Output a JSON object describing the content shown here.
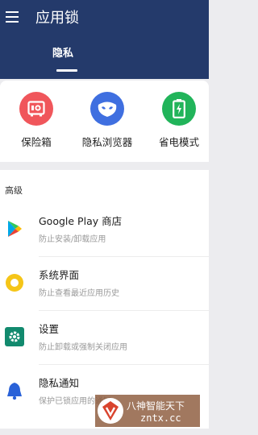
{
  "app": {
    "title": "应用锁"
  },
  "tabs": [
    {
      "label": "隐私",
      "active": true
    }
  ],
  "features": [
    {
      "label": "保险箱",
      "icon": "safe-icon",
      "color": "#f0565b"
    },
    {
      "label": "隐私浏览器",
      "icon": "incognito-mask-icon",
      "color": "#3f6fe0"
    },
    {
      "label": "省电模式",
      "icon": "battery-icon",
      "color": "#21b45a"
    }
  ],
  "pager": {
    "active_color": "#2bb3d6",
    "inactive_color": "#c9c9c9"
  },
  "advanced": {
    "section_title": "高级",
    "items": [
      {
        "title": "Google Play 商店",
        "desc": "防止安装/卸载应用",
        "icon": "google-play-icon"
      },
      {
        "title": "系统界面",
        "desc": "防止查看最近应用历史",
        "icon": "system-ui-icon",
        "color": "#f5c518"
      },
      {
        "title": "设置",
        "desc": "防止卸载或强制关闭应用",
        "icon": "settings-gear-icon",
        "color": "#128a6e"
      },
      {
        "title": "隐私通知",
        "desc": "保护已锁应用的通知",
        "icon": "bell-icon",
        "color": "#2a62d8"
      }
    ]
  },
  "watermark": {
    "line1": "八神智能天下",
    "line2": "zntx.cc"
  },
  "colors": {
    "header_bg": "#243a6b",
    "page_bg": "#ececef"
  }
}
